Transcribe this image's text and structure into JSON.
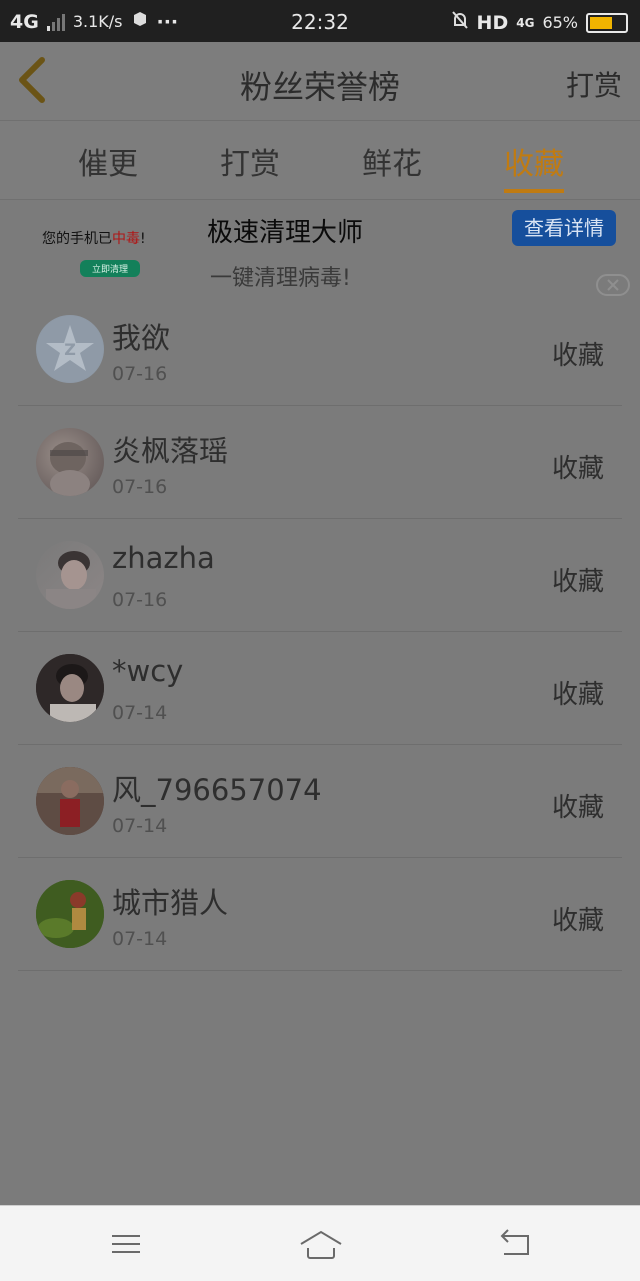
{
  "status_bar": {
    "network": "4G",
    "speed": "3.1K/s",
    "dots": "···",
    "time": "22:32",
    "hd": "HD",
    "net4g": "4G",
    "battery": "65%",
    "battery_level": 0.65
  },
  "header": {
    "title": "粉丝荣誉榜",
    "right_action": "打赏",
    "back_icon": "chevron-left-icon"
  },
  "tabs": [
    {
      "label": "催更",
      "active": false
    },
    {
      "label": "打赏",
      "active": false
    },
    {
      "label": "鲜花",
      "active": false
    },
    {
      "label": "收藏",
      "active": true
    }
  ],
  "ad": {
    "thumb_text_prefix": "您的手机已",
    "thumb_text_red": "中毒",
    "thumb_text_suffix": "!",
    "thumb_button": "立即清理",
    "title": "极速清理大师",
    "subtitle": "一键清理病毒!",
    "detail_button": "查看详情"
  },
  "list": [
    {
      "name": "我欲",
      "date": "07-16",
      "action": "收藏",
      "avatar": "qq-default-avatar"
    },
    {
      "name": "炎枫落瑶",
      "date": "07-16",
      "action": "收藏",
      "avatar": "user-avatar"
    },
    {
      "name": "zhazha",
      "date": "07-16",
      "action": "收藏",
      "avatar": "user-avatar"
    },
    {
      "name": "*wcy",
      "date": "07-14",
      "action": "收藏",
      "avatar": "user-avatar"
    },
    {
      "name": "风_796657074",
      "date": "07-14",
      "action": "收藏",
      "avatar": "user-avatar"
    },
    {
      "name": "城市猎人",
      "date": "07-14",
      "action": "收藏",
      "avatar": "user-avatar"
    }
  ],
  "navbar": {
    "menu_icon": "menu-icon",
    "home_icon": "home-icon",
    "back_icon": "back-icon"
  },
  "colors": {
    "accent": "#c07b12",
    "overlay_bg": "#7b7b7b"
  }
}
